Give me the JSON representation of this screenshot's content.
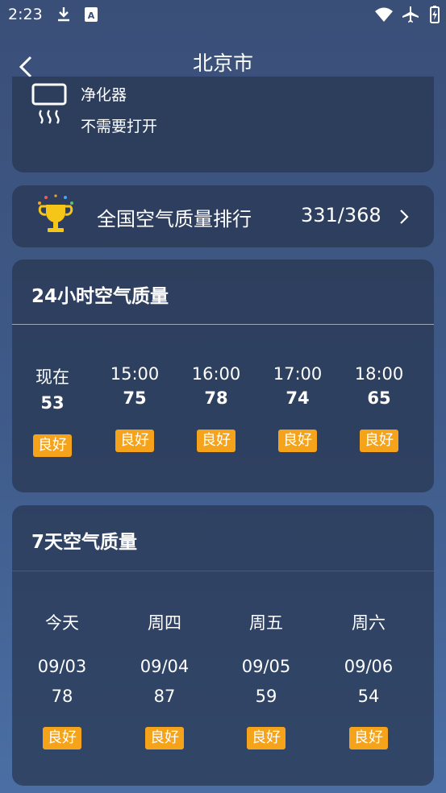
{
  "status_bar": {
    "time": "2:23"
  },
  "header": {
    "title": "北京市"
  },
  "purifier": {
    "name": "净化器",
    "advice": "不需要打开"
  },
  "rank": {
    "label": "全国空气质量排行",
    "value": "331/368"
  },
  "hourly": {
    "title": "24小时空气质量",
    "items": [
      {
        "time": "现在",
        "aqi": "53",
        "level": "良好"
      },
      {
        "time": "15:00",
        "aqi": "75",
        "level": "良好"
      },
      {
        "time": "16:00",
        "aqi": "78",
        "level": "良好"
      },
      {
        "time": "17:00",
        "aqi": "74",
        "level": "良好"
      },
      {
        "time": "18:00",
        "aqi": "65",
        "level": "良好"
      }
    ]
  },
  "daily": {
    "title": "7天空气质量",
    "items": [
      {
        "day": "今天",
        "date": "09/03",
        "aqi": "78",
        "level": "良好"
      },
      {
        "day": "周四",
        "date": "09/04",
        "aqi": "87",
        "level": "良好"
      },
      {
        "day": "周五",
        "date": "09/05",
        "aqi": "59",
        "level": "良好"
      },
      {
        "day": "周六",
        "date": "09/06",
        "aqi": "54",
        "level": "良好"
      }
    ]
  },
  "colors": {
    "badge": "#f5a31a",
    "card": "#283650"
  },
  "icons": [
    "download-icon",
    "sim-icon",
    "wifi-icon",
    "airplane-icon",
    "battery-icon",
    "back-icon",
    "purifier-icon",
    "trophy-icon",
    "chevron-right-icon"
  ]
}
